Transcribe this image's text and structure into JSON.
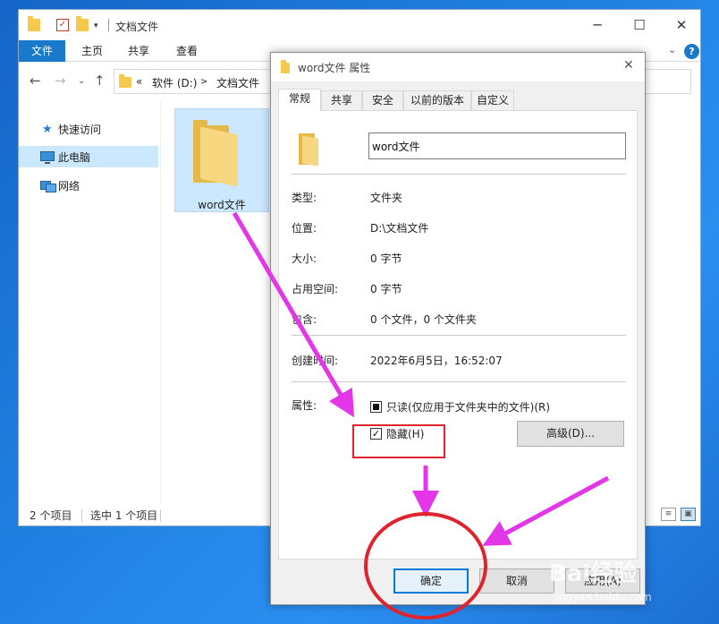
{
  "explorer": {
    "title": "文档文件",
    "ribbon_tabs": [
      "文件",
      "主页",
      "共享",
      "查看"
    ],
    "address": {
      "prefix": "«",
      "segments": [
        "软件 (D:)",
        "文档文件"
      ],
      "separator": ">"
    },
    "nav_items": [
      {
        "label": "快速访问",
        "icon": "star-icon"
      },
      {
        "label": "此电脑",
        "icon": "computer-icon",
        "selected": true
      },
      {
        "label": "网络",
        "icon": "network-icon"
      }
    ],
    "file": {
      "name": "word文件"
    },
    "status": {
      "item_count": "2 个项目",
      "selected_count": "选中 1 个项目"
    }
  },
  "dialog": {
    "title": "word文件 属性",
    "tabs": [
      "常规",
      "共享",
      "安全",
      "以前的版本",
      "自定义"
    ],
    "name_value": "word文件",
    "properties": [
      {
        "label": "类型:",
        "value": "文件夹"
      },
      {
        "label": "位置:",
        "value": "D:\\文档文件"
      },
      {
        "label": "大小:",
        "value": "0 字节"
      },
      {
        "label": "占用空间:",
        "value": "0 字节"
      },
      {
        "label": "包含:",
        "value": "0 个文件，0 个文件夹"
      }
    ],
    "created": {
      "label": "创建时间:",
      "value": "2022年6月5日，16:52:07"
    },
    "attributes_label": "属性:",
    "readonly_label": "只读(仅应用于文件夹中的文件)(R)",
    "hidden_label": "隐藏(H)",
    "hidden_checked": true,
    "readonly_state": "indeterminate",
    "advanced_button": "高级(D)...",
    "ok_button": "确定",
    "cancel_button": "取消",
    "apply_button": "应用(A)"
  },
  "watermark": {
    "brand": "Bai经验",
    "url": "jingyan.baidu.com"
  },
  "colors": {
    "desktop": "#1f7fe0",
    "ribbon_active": "#1979ca",
    "selection": "#cce8ff",
    "annotation_arrow": "#e236e8",
    "annotation_red": "#e0242e"
  }
}
